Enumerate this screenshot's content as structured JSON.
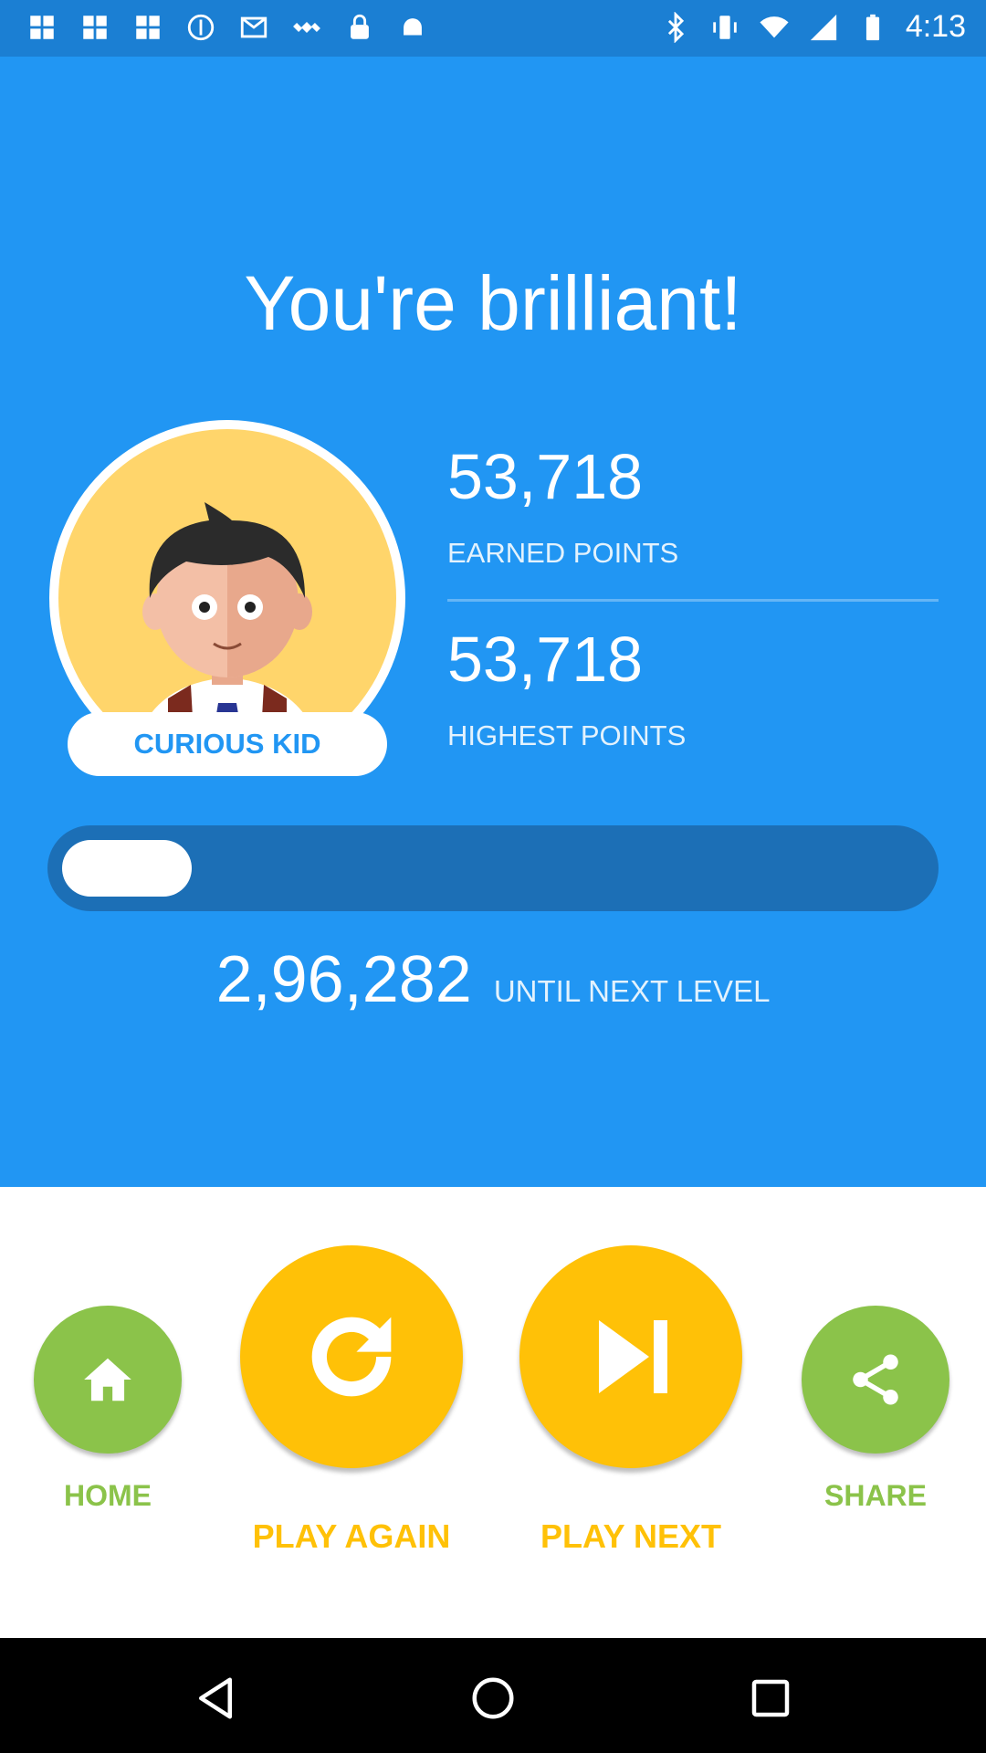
{
  "status_bar": {
    "time": "4:13",
    "left_icons": [
      "app-icon",
      "app-icon",
      "app-icon",
      "sync-icon",
      "mail-icon",
      "satellite-icon",
      "lock-icon",
      "android-icon"
    ],
    "right_icons": [
      "bluetooth-icon",
      "vibrate-icon",
      "wifi-icon",
      "signal-icon",
      "battery-icon"
    ]
  },
  "result": {
    "headline": "You're brilliant!",
    "rank_title": "CURIOUS KID",
    "earned_points": "53,718",
    "earned_label": "EARNED POINTS",
    "highest_points": "53,718",
    "highest_label": "HIGHEST POINTS",
    "progress_fraction": 0.15,
    "points_to_next": "2,96,282",
    "next_level_label": "UNTIL NEXT LEVEL"
  },
  "actions": {
    "home_label": "HOME",
    "play_again_label": "PLAY AGAIN",
    "play_next_label": "PLAY NEXT",
    "share_label": "SHARE"
  },
  "colors": {
    "primary_blue": "#2196f3",
    "status_blue": "#1b7fd3",
    "green": "#8bc34a",
    "yellow": "#ffc107"
  }
}
